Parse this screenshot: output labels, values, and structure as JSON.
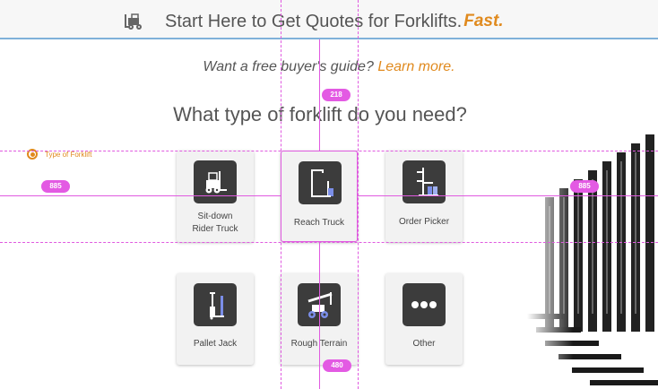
{
  "header": {
    "title": "Start Here to Get Quotes for Forklifts.",
    "accent": "Fast.",
    "icon": "forklift-icon"
  },
  "guide": {
    "prefix": "Want a free buyer's guide?",
    "link": "Learn more."
  },
  "question": "What type of forklift do you need?",
  "step": {
    "label": "Type of Forklift"
  },
  "options": [
    {
      "label_line1": "Sit-down",
      "label_line2": "Rider Truck",
      "icon": "sit-down-forklift-icon"
    },
    {
      "label_line1": "Reach Truck",
      "icon": "reach-truck-icon"
    },
    {
      "label_line1": "Order Picker",
      "icon": "order-picker-icon"
    },
    {
      "label_line1": "Pallet Jack",
      "icon": "pallet-jack-icon"
    },
    {
      "label_line1": "Rough Terrain",
      "icon": "rough-terrain-forklift-icon"
    },
    {
      "label_line1": "Other",
      "icon": "more-dots-icon"
    }
  ],
  "measurements": {
    "top_gap": "218",
    "left_gap": "885",
    "right_gap": "885",
    "bottom_gap": "480"
  },
  "colors": {
    "accent": "#e08a1e",
    "guide": "#e05ae0",
    "tile": "#3c3c3c",
    "icon_highlight": "#7b8ee8"
  }
}
